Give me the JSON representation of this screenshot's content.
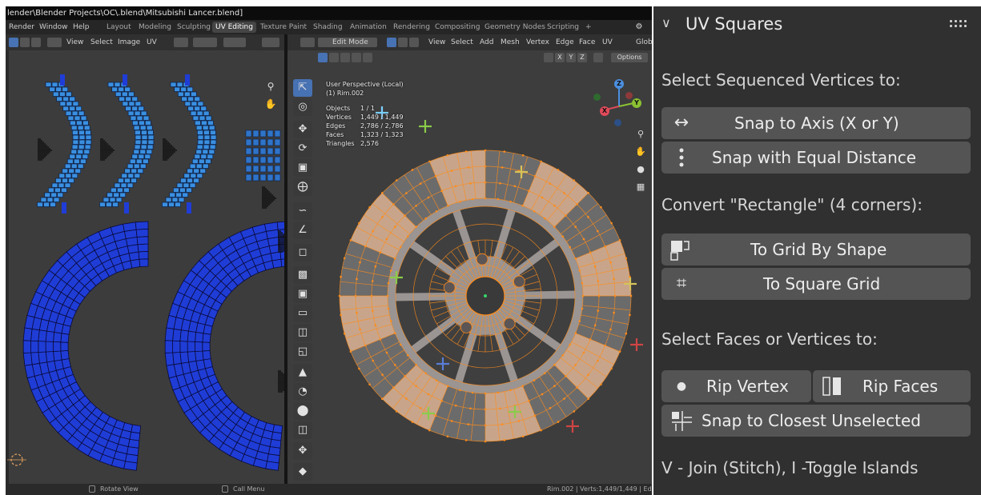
{
  "window": {
    "title": "lender\\Blender Projects\\OC\\.blend\\Mitsubishi Lancer.blend]"
  },
  "menubar": {
    "menus": [
      "Render",
      "Window",
      "Help"
    ],
    "workspaces": [
      "Layout",
      "Modeling",
      "Sculpting",
      "UV Editing",
      "Texture Paint",
      "Shading",
      "Animation",
      "Rendering",
      "Compositing",
      "Geometry Nodes",
      "Scripting"
    ],
    "active_workspace": "UV Editing",
    "add_tab": "+"
  },
  "uv_editor": {
    "header_menus": [
      "View",
      "Select",
      "Image",
      "UV"
    ],
    "face_color": "#1f3dd6",
    "island_color": "#3a8fe0",
    "background": "#3c3c3c"
  },
  "viewport": {
    "mode": "Edit Mode",
    "header_menus": [
      "View",
      "Select",
      "Add",
      "Mesh",
      "Vertex",
      "Edge",
      "Face",
      "UV"
    ],
    "transform_orientation": "Glob",
    "options_label": "Options",
    "axis_toggles": [
      "X",
      "Y",
      "Z"
    ],
    "info": {
      "perspective": "User Perspective (Local)",
      "object": "(1) Rim.002",
      "stats": [
        {
          "label": "Objects",
          "value": "1 / 1"
        },
        {
          "label": "Vertices",
          "value": "1,449 / 1,449"
        },
        {
          "label": "Edges",
          "value": "2,786 / 2,786"
        },
        {
          "label": "Faces",
          "value": "1,323 / 1,323"
        },
        {
          "label": "Triangles",
          "value": "2,576"
        }
      ]
    },
    "gizmo_axes": [
      "Z",
      "X",
      "Y"
    ],
    "mesh_color": "#ff8c1a",
    "checker_light": "#c8a58a",
    "checker_dark": "#6b6b6b"
  },
  "statusbar": {
    "left_hint": "Rotate View",
    "mid_hint": "Call Menu",
    "right_stats": "Rim.002 | Verts:1,449/1,449 | Ed"
  },
  "panel": {
    "title": "UV Squares",
    "section_sequenced": "Select Sequenced Vertices to:",
    "snap_axis": "Snap to Axis (X or Y)",
    "snap_equal": "Snap with Equal Distance",
    "section_rectangle": "Convert \"Rectangle\" (4 corners):",
    "grid_by_shape": "To Grid By Shape",
    "square_grid": "To Square Grid",
    "section_faces": "Select Faces or Vertices to:",
    "rip_vertex": "Rip Vertex",
    "rip_faces": "Rip Faces",
    "snap_closest": "Snap to Closest Unselected",
    "shortcut_hint": "V - Join (Stitch), I -Toggle Islands",
    "icons": {
      "snap_axis": "↔",
      "square_grid": "⌗",
      "rip_vertex": "●"
    }
  }
}
